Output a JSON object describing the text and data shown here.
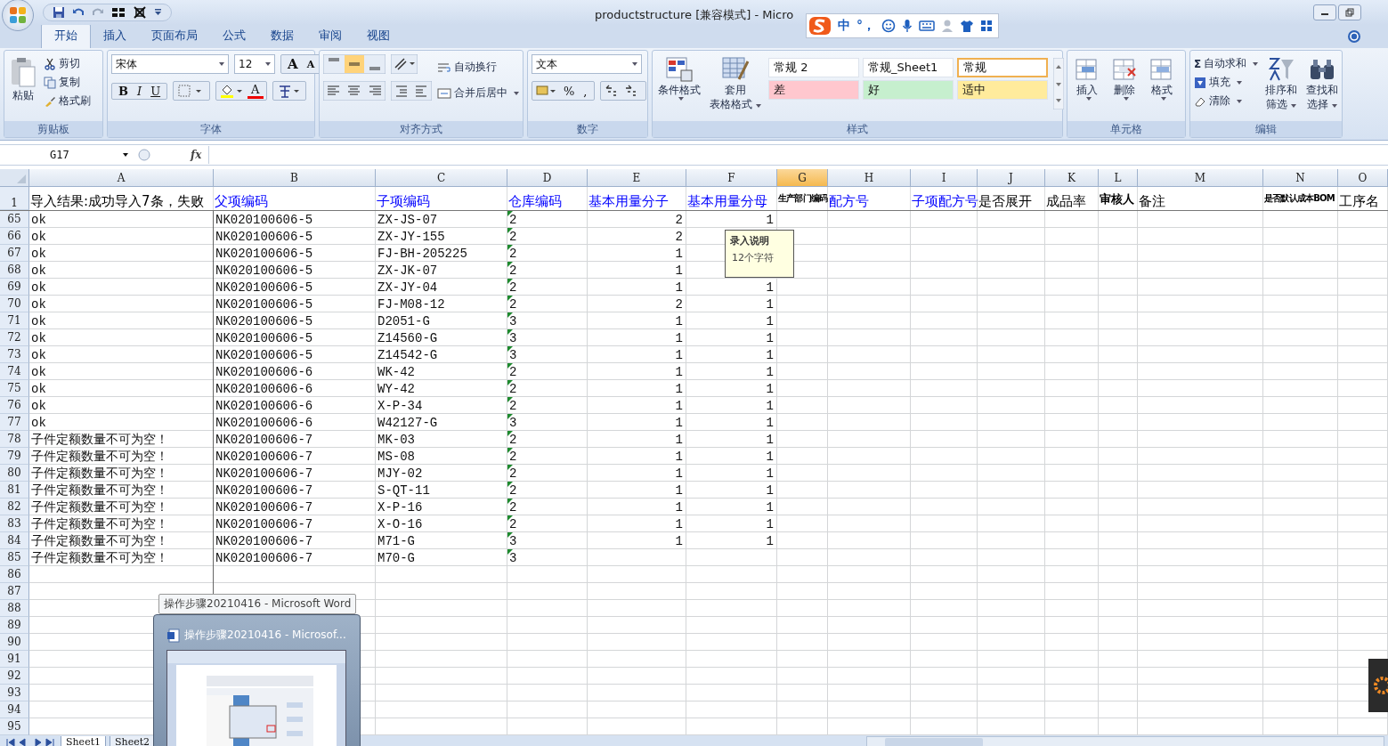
{
  "window": {
    "title": "productstructure  [兼容模式] - Micro"
  },
  "ime": {
    "mode": "中",
    "punct": "°，"
  },
  "tabs": [
    {
      "label": "开始",
      "selected": true
    },
    {
      "label": "插入",
      "selected": false
    },
    {
      "label": "页面布局",
      "selected": false
    },
    {
      "label": "公式",
      "selected": false
    },
    {
      "label": "数据",
      "selected": false
    },
    {
      "label": "审阅",
      "selected": false
    },
    {
      "label": "视图",
      "selected": false
    }
  ],
  "ribbon": {
    "clipboard": {
      "paste": "粘贴",
      "items": [
        "剪切",
        "复制",
        "格式刷"
      ],
      "label": "剪贴板"
    },
    "font": {
      "name": "宋体",
      "size": "12",
      "grow": "A",
      "shrink": "A",
      "styles": [
        "B",
        "I",
        "U"
      ],
      "color_letter": "A",
      "label": "字体"
    },
    "alignment": {
      "wrap": "自动换行",
      "merge": "合并后居中",
      "label": "对齐方式"
    },
    "number": {
      "format": "文本",
      "percent": "%",
      "comma": ",",
      "label": "数字"
    },
    "styles": {
      "conditional": "条件格式",
      "table_format": [
        "套用",
        "表格格式"
      ],
      "label": "样式",
      "cells": [
        {
          "text": "常规 2",
          "color": "#ffffff",
          "selected": false
        },
        {
          "text": "常规_Sheet1",
          "color": "#ffffff",
          "selected": false
        },
        {
          "text": "常规",
          "color": "#ffffff",
          "selected": true
        },
        {
          "text": "差",
          "color": "#ffc7ce",
          "selected": false
        },
        {
          "text": "好",
          "color": "#c6efce",
          "selected": false
        },
        {
          "text": "适中",
          "color": "#ffeb9c",
          "selected": false
        }
      ]
    },
    "cells": {
      "buttons": [
        "插入",
        "删除",
        "格式"
      ],
      "label": "单元格"
    },
    "editing": {
      "sum_sign": "Σ",
      "small": [
        "自动求和",
        "填充",
        "清除"
      ],
      "sort": [
        "排序和",
        "筛选"
      ],
      "find": [
        "查找和",
        "选择"
      ],
      "label": "编辑"
    }
  },
  "formula_bar": {
    "name_box": "G17",
    "fx": "fx"
  },
  "columns": [
    {
      "letter": "A",
      "selected": false
    },
    {
      "letter": "B",
      "selected": false
    },
    {
      "letter": "C",
      "selected": false
    },
    {
      "letter": "D",
      "selected": false
    },
    {
      "letter": "E",
      "selected": false
    },
    {
      "letter": "F",
      "selected": false
    },
    {
      "letter": "G",
      "selected": true
    },
    {
      "letter": "H",
      "selected": false
    },
    {
      "letter": "I",
      "selected": false
    },
    {
      "letter": "J",
      "selected": false
    },
    {
      "letter": "K",
      "selected": false
    },
    {
      "letter": "L",
      "selected": false
    },
    {
      "letter": "M",
      "selected": false
    },
    {
      "letter": "N",
      "selected": false
    },
    {
      "letter": "O",
      "selected": false
    }
  ],
  "header_row": {
    "num": "1",
    "cells": [
      {
        "text": "导入结果:成功导入7条，失败",
        "color": "#000000",
        "kind": "normal"
      },
      {
        "text": "父项编码",
        "color": "#0000ff",
        "kind": "normal"
      },
      {
        "text": "子项编码",
        "color": "#0000ff",
        "kind": "normal"
      },
      {
        "text": "仓库编码",
        "color": "#0000ff",
        "kind": "normal"
      },
      {
        "text": "基本用量分子",
        "color": "#0000ff",
        "kind": "normal"
      },
      {
        "text": "基本用量分母",
        "color": "#0000ff",
        "kind": "normal"
      },
      {
        "text": "生产部门编码",
        "color": "#000000",
        "kind": "compact"
      },
      {
        "text": "配方号",
        "color": "#0000ff",
        "kind": "normal"
      },
      {
        "text": "子项配方号",
        "color": "#0000ff",
        "kind": "normal"
      },
      {
        "text": "是否展开",
        "color": "#000000",
        "kind": "normal"
      },
      {
        "text": "成品率",
        "color": "#000000",
        "kind": "normal"
      },
      {
        "text": "审核人",
        "color": "#000000",
        "kind": "small"
      },
      {
        "text": "备注",
        "color": "#000000",
        "kind": "normal"
      },
      {
        "text": "是否默认成本BOM",
        "color": "#000000",
        "kind": "compact"
      },
      {
        "text": "工序名",
        "color": "#000000",
        "kind": "normal"
      }
    ]
  },
  "rows": [
    {
      "num": "65",
      "a": "ok",
      "b": "NK020100606-5",
      "c": "ZX-JS-07",
      "d": "2",
      "d_flag": true,
      "e": "2",
      "f": "1"
    },
    {
      "num": "66",
      "a": "ok",
      "b": "NK020100606-5",
      "c": "ZX-JY-155",
      "d": "2",
      "d_flag": true,
      "e": "2"
    },
    {
      "num": "67",
      "a": "ok",
      "b": "NK020100606-5",
      "c": "FJ-BH-205225",
      "d": "2",
      "d_flag": true,
      "e": "1"
    },
    {
      "num": "68",
      "a": "ok",
      "b": "NK020100606-5",
      "c": "ZX-JK-07",
      "d": "2",
      "d_flag": true,
      "e": "1"
    },
    {
      "num": "69",
      "a": "ok",
      "b": "NK020100606-5",
      "c": "ZX-JY-04",
      "d": "2",
      "d_flag": true,
      "e": "1",
      "f": "1"
    },
    {
      "num": "70",
      "a": "ok",
      "b": "NK020100606-5",
      "c": "FJ-M08-12",
      "d": "2",
      "d_flag": true,
      "e": "2",
      "f": "1"
    },
    {
      "num": "71",
      "a": "ok",
      "b": "NK020100606-5",
      "c": "D2051-G",
      "d": "3",
      "d_flag": true,
      "e": "1",
      "f": "1"
    },
    {
      "num": "72",
      "a": "ok",
      "b": "NK020100606-5",
      "c": "Z14560-G",
      "d": "3",
      "d_flag": true,
      "e": "1",
      "f": "1"
    },
    {
      "num": "73",
      "a": "ok",
      "b": "NK020100606-5",
      "c": "Z14542-G",
      "d": "3",
      "d_flag": true,
      "e": "1",
      "f": "1"
    },
    {
      "num": "74",
      "a": "ok",
      "b": "NK020100606-6",
      "c": "WK-42",
      "d": "2",
      "d_flag": true,
      "e": "1",
      "f": "1"
    },
    {
      "num": "75",
      "a": "ok",
      "b": "NK020100606-6",
      "c": "WY-42",
      "d": "2",
      "d_flag": true,
      "e": "1",
      "f": "1"
    },
    {
      "num": "76",
      "a": "ok",
      "b": "NK020100606-6",
      "c": "X-P-34",
      "d": "2",
      "d_flag": true,
      "e": "1",
      "f": "1"
    },
    {
      "num": "77",
      "a": "ok",
      "b": "NK020100606-6",
      "c": "W42127-G",
      "d": "3",
      "d_flag": true,
      "e": "1",
      "f": "1"
    },
    {
      "num": "78",
      "a": "子件定额数量不可为空！",
      "b": "NK020100606-7",
      "c": "MK-03",
      "d": "2",
      "d_flag": true,
      "e": "1",
      "f": "1"
    },
    {
      "num": "79",
      "a": "子件定额数量不可为空！",
      "b": "NK020100606-7",
      "c": "MS-08",
      "d": "2",
      "d_flag": true,
      "e": "1",
      "f": "1"
    },
    {
      "num": "80",
      "a": "子件定额数量不可为空！",
      "b": "NK020100606-7",
      "c": "MJY-02",
      "d": "2",
      "d_flag": true,
      "e": "1",
      "f": "1"
    },
    {
      "num": "81",
      "a": "子件定额数量不可为空！",
      "b": "NK020100606-7",
      "c": "S-QT-11",
      "d": "2",
      "d_flag": true,
      "e": "1",
      "f": "1"
    },
    {
      "num": "82",
      "a": "子件定额数量不可为空！",
      "b": "NK020100606-7",
      "c": "X-P-16",
      "d": "2",
      "d_flag": true,
      "e": "1",
      "f": "1"
    },
    {
      "num": "83",
      "a": "子件定额数量不可为空！",
      "b": "NK020100606-7",
      "c": "X-O-16",
      "d": "2",
      "d_flag": true,
      "e": "1",
      "f": "1"
    },
    {
      "num": "84",
      "a": "子件定额数量不可为空！",
      "b": "NK020100606-7",
      "c": "M71-G",
      "d": "3",
      "d_flag": true,
      "e": "1",
      "f": "1"
    },
    {
      "num": "85",
      "a": "子件定额数量不可为空！",
      "b": "NK020100606-7",
      "c": "M70-G",
      "d": "3",
      "d_flag": true
    },
    {
      "num": "86"
    },
    {
      "num": "87"
    },
    {
      "num": "88"
    },
    {
      "num": "89"
    },
    {
      "num": "90"
    },
    {
      "num": "91"
    },
    {
      "num": "92"
    },
    {
      "num": "93"
    },
    {
      "num": "94"
    },
    {
      "num": "95"
    }
  ],
  "tooltip": {
    "title": "录入说明",
    "body": "12个字符"
  },
  "sheets": [
    {
      "label": "Sheet1",
      "selected": true
    },
    {
      "label": "Sheet2",
      "selected": false
    }
  ],
  "taskbar_preview": {
    "label": "操作步骤20210416 - Microsoft Word",
    "title": "操作步骤20210416 - Microsof..."
  }
}
